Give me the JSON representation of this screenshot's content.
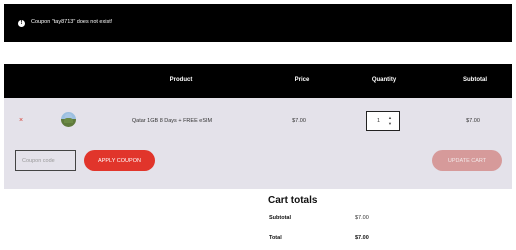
{
  "notice": {
    "message": "Coupon \"tay8713\" does not exist!",
    "icon": "info-icon"
  },
  "table": {
    "headers": {
      "product": "Product",
      "price": "Price",
      "quantity": "Quantity",
      "subtotal": "Subtotal"
    },
    "items": [
      {
        "remove": "×",
        "name": "Qatar 1GB 8 Days + FREE eSIM",
        "price": "$7.00",
        "quantity": "1",
        "subtotal": "$7.00"
      }
    ]
  },
  "coupon": {
    "placeholder": "Coupon code",
    "apply_label": "APPLY COUPON",
    "update_label": "UPDATE CART"
  },
  "totals": {
    "heading": "Cart totals",
    "subtotal_label": "Subtotal",
    "subtotal_value": "$7.00",
    "total_label": "Total",
    "total_value": "$7.00"
  },
  "colors": {
    "accent": "#e1352b",
    "header_bg": "#000000",
    "row_bg": "#e4e2ea"
  }
}
